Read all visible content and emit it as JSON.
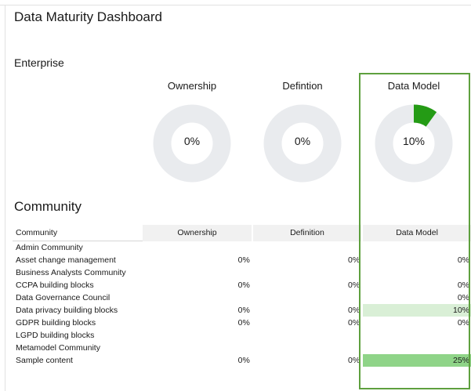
{
  "page_title": "Data Maturity Dashboard",
  "enterprise": {
    "section_title": "Enterprise",
    "donuts": [
      {
        "label": "Ownership",
        "value_text": "0%",
        "fraction": 0.0
      },
      {
        "label": "Defintion",
        "value_text": "0%",
        "fraction": 0.0
      },
      {
        "label": "Data Model",
        "value_text": "10%",
        "fraction": 0.1
      }
    ],
    "track_color": "#e9ebee",
    "fill_color": "#249b15"
  },
  "community": {
    "section_title": "Community",
    "headers": [
      "Community",
      "Ownership",
      "Definition",
      "Data Model"
    ],
    "rows": [
      {
        "name": "Admin Community",
        "ownership": "",
        "definition": "",
        "data_model": "",
        "data_model_fraction": 0
      },
      {
        "name": "Asset change management",
        "ownership": "0%",
        "definition": "0%",
        "data_model": "0%",
        "data_model_fraction": 0
      },
      {
        "name": "Business Analysts Community",
        "ownership": "",
        "definition": "",
        "data_model": "",
        "data_model_fraction": 0
      },
      {
        "name": "CCPA building blocks",
        "ownership": "0%",
        "definition": "0%",
        "data_model": "0%",
        "data_model_fraction": 0
      },
      {
        "name": "Data Governance Council",
        "ownership": "",
        "definition": "",
        "data_model": "0%",
        "data_model_fraction": 0
      },
      {
        "name": "Data privacy building blocks",
        "ownership": "0%",
        "definition": "0%",
        "data_model": "10%",
        "data_model_fraction": 0.1
      },
      {
        "name": "GDPR building blocks",
        "ownership": "0%",
        "definition": "0%",
        "data_model": "0%",
        "data_model_fraction": 0
      },
      {
        "name": "LGPD building blocks",
        "ownership": "",
        "definition": "",
        "data_model": "",
        "data_model_fraction": 0
      },
      {
        "name": "Metamodel Community",
        "ownership": "",
        "definition": "",
        "data_model": "",
        "data_model_fraction": 0
      },
      {
        "name": "Sample content",
        "ownership": "0%",
        "definition": "0%",
        "data_model": "25%",
        "data_model_fraction": 0.25
      }
    ],
    "shade_light": "#d9efd6",
    "shade_strong": "#8fd488"
  },
  "highlight_color": "#5ea03e"
}
